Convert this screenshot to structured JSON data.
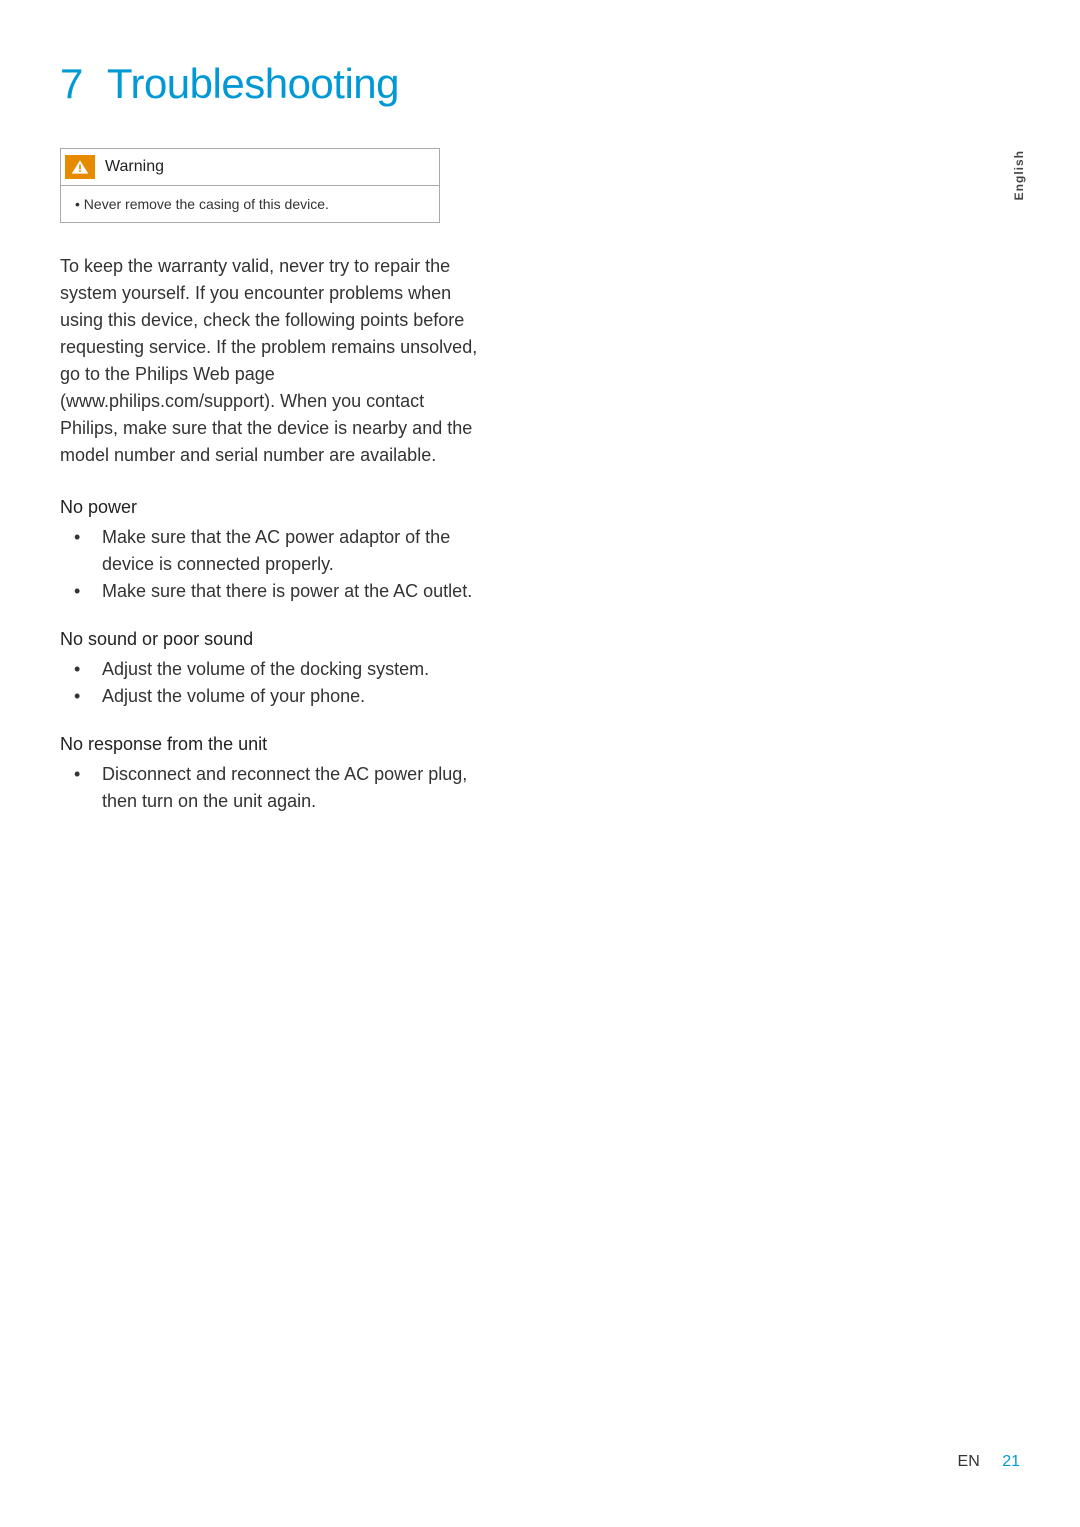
{
  "heading": {
    "number": "7",
    "title": "Troubleshooting"
  },
  "warning": {
    "label": "Warning",
    "text": "Never remove the casing of this device."
  },
  "intro": "To keep the warranty valid, never try to repair the system yourself.\nIf you encounter problems when using this device, check the following points before requesting service. If the problem remains unsolved, go to the Philips Web page (www.philips.com/support). When you contact Philips, make sure that the device is nearby and the model number and serial number are available.",
  "sections": [
    {
      "title": "No power",
      "items": [
        "Make sure that the AC power adaptor of the device is connected properly.",
        "Make sure that there is power at the AC outlet."
      ]
    },
    {
      "title": "No sound or poor sound",
      "items": [
        "Adjust the volume of the docking system.",
        "Adjust the volume of your phone."
      ]
    },
    {
      "title": "No response from the unit",
      "items": [
        "Disconnect and reconnect the AC power plug, then turn on the unit again."
      ]
    }
  ],
  "sideTab": "English",
  "footer": {
    "lang": "EN",
    "page": "21"
  }
}
